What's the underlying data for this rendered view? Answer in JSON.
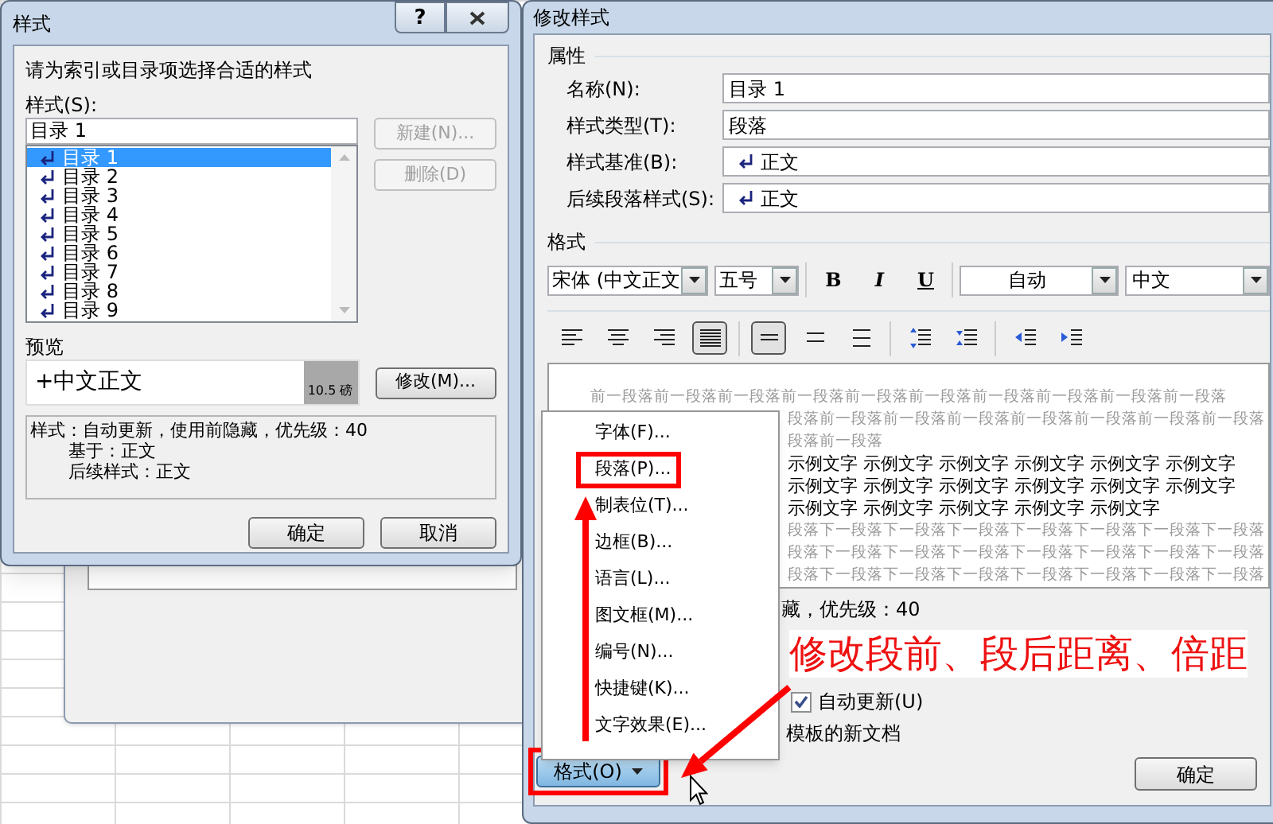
{
  "styles_dialog": {
    "title": "样式",
    "help_label": "?",
    "instruction": "请为索引或目录项选择合适的样式",
    "styles_label": "样式(S):",
    "style_name": "目录 1",
    "style_list": [
      {
        "label": "目录 1",
        "selected": true
      },
      {
        "label": "目录 2",
        "selected": false
      },
      {
        "label": "目录 3",
        "selected": false
      },
      {
        "label": "目录 4",
        "selected": false
      },
      {
        "label": "目录 5",
        "selected": false
      },
      {
        "label": "目录 6",
        "selected": false
      },
      {
        "label": "目录 7",
        "selected": false
      },
      {
        "label": "目录 8",
        "selected": false
      },
      {
        "label": "目录 9",
        "selected": false
      }
    ],
    "side_buttons": [
      {
        "label": "新建(N)...",
        "disabled": true
      },
      {
        "label": "删除(D)",
        "disabled": true
      }
    ],
    "preview_label": "预览",
    "preview_text": "+中文正文",
    "preview_size": "10.5 磅",
    "modify_button": "修改(M)...",
    "description_lines": [
      "样式：自动更新，使用前隐藏，优先级：40",
      "基于：正文",
      "后续样式：正文"
    ],
    "ok_button": "确定",
    "cancel_button": "取消"
  },
  "modify_dialog": {
    "title": "修改样式",
    "properties_label": "属性",
    "fields": [
      {
        "label": "名称(N):",
        "value": "目录 1",
        "kind": "text"
      },
      {
        "label": "样式类型(T):",
        "value": "段落",
        "kind": "text"
      },
      {
        "label": "样式基准(B):",
        "value": "正文",
        "kind": "style"
      },
      {
        "label": "后续段落样式(S):",
        "value": "正文",
        "kind": "style"
      }
    ],
    "format_label": "格式",
    "font": "宋体 (中文正文",
    "size": "五号",
    "bold_label": "B",
    "italic_label": "I",
    "underline_label": "U",
    "font_color_setting": "自动",
    "script": "中文",
    "align_buttons": [
      {
        "kind": "align-left",
        "selected": false
      },
      {
        "kind": "align-center",
        "selected": false
      },
      {
        "kind": "align-right",
        "selected": false
      },
      {
        "kind": "justify",
        "selected": true
      },
      {
        "kind": "single-spacing",
        "selected": true
      },
      {
        "kind": "one-half-spacing",
        "selected": false
      },
      {
        "kind": "double-spacing",
        "selected": false
      },
      {
        "kind": "space-increase",
        "selected": false
      },
      {
        "kind": "space-decrease",
        "selected": false
      },
      {
        "kind": "indent-decrease",
        "selected": false
      },
      {
        "kind": "indent-increase",
        "selected": false
      }
    ],
    "preview_lines": [
      {
        "kind": "previous",
        "text": "前一段落前一段落前一段落前一段落前一段落前一段落前一段落前一段落前一段落前一段落"
      },
      {
        "kind": "previous",
        "text": "段落前一段落前一段落前一段落前一段落前一段落前一段落前一段落"
      },
      {
        "kind": "previous",
        "text": "段落前一段落"
      },
      {
        "kind": "sample",
        "text": "示例文字 示例文字 示例文字 示例文字 示例文字 示例文字"
      },
      {
        "kind": "sample",
        "text": "示例文字 示例文字 示例文字 示例文字 示例文字 示例文字"
      },
      {
        "kind": "sample",
        "text": "示例文字 示例文字 示例文字 示例文字 示例文字"
      },
      {
        "kind": "next",
        "text": "段落下一段落下一段落下一段落下一段落下一段落下一段落下一段落"
      },
      {
        "kind": "next",
        "text": "段落下一段落下一段落下一段落下一段落下一段落下一段落下一段落"
      },
      {
        "kind": "next",
        "text": "段落下一段落下一段落下一段落下一段落下一段落下一段落下一段落"
      }
    ],
    "description": "藏，优先级：40",
    "auto_update": {
      "label": "自动更新(U)",
      "checked": true
    },
    "template_text": "模板的新文档",
    "format_button": "格式(O)",
    "ok_button": "确定"
  },
  "format_menu": {
    "items": [
      {
        "label": "字体(F)...",
        "highlighted": false
      },
      {
        "label": "段落(P)...",
        "highlighted": true
      },
      {
        "label": "制表位(T)...",
        "highlighted": false
      },
      {
        "label": "边框(B)...",
        "highlighted": false
      },
      {
        "label": "语言(L)...",
        "highlighted": false
      },
      {
        "label": "图文框(M)...",
        "highlighted": false
      },
      {
        "label": "编号(N)...",
        "highlighted": false
      },
      {
        "label": "快捷键(K)...",
        "highlighted": false
      },
      {
        "label": "文字效果(E)...",
        "highlighted": false
      }
    ]
  },
  "annotation": "修改段前、段后距离、倍距"
}
